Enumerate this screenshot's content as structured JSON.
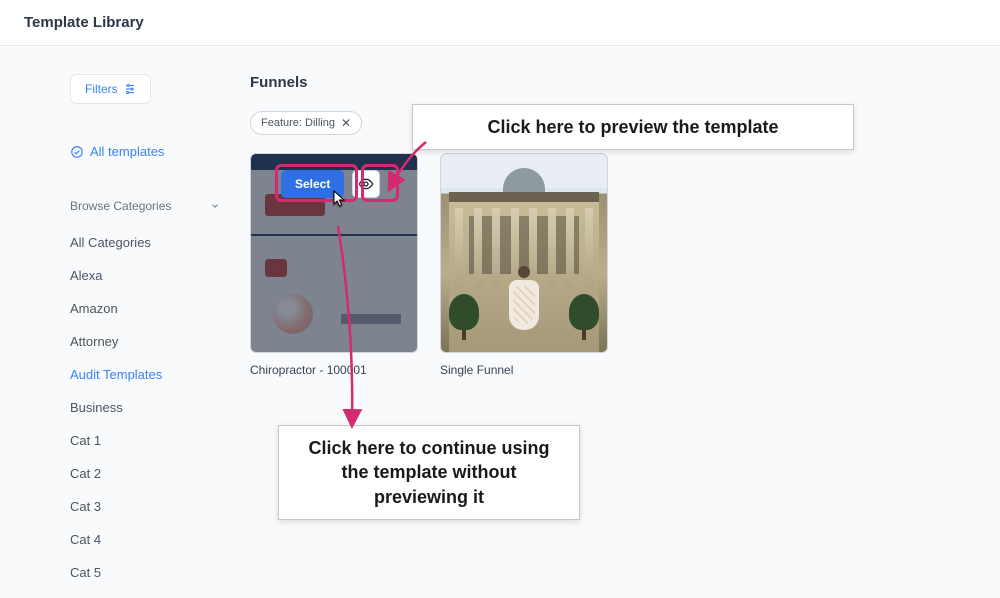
{
  "header": {
    "title": "Template Library"
  },
  "sidebar": {
    "filters_label": "Filters",
    "all_templates_label": "All templates",
    "browse_label": "Browse Categories",
    "categories": [
      {
        "label": "All Categories",
        "active": false
      },
      {
        "label": "Alexa",
        "active": false
      },
      {
        "label": "Amazon",
        "active": false
      },
      {
        "label": "Attorney",
        "active": false
      },
      {
        "label": "Audit Templates",
        "active": true
      },
      {
        "label": "Business",
        "active": false
      },
      {
        "label": "Cat 1",
        "active": false
      },
      {
        "label": "Cat 2",
        "active": false
      },
      {
        "label": "Cat 3",
        "active": false
      },
      {
        "label": "Cat 4",
        "active": false
      },
      {
        "label": "Cat 5",
        "active": false
      }
    ]
  },
  "main": {
    "section_title": "Funnels",
    "filter_chip": "Feature: Dilling",
    "cards": [
      {
        "title": "Chiropractor - 100001",
        "select_label": "Select"
      },
      {
        "title": "Single Funnel"
      }
    ]
  },
  "callouts": {
    "preview": "Click here to preview the template",
    "select": "Click here to continue using the template without previewing it"
  },
  "colors": {
    "accent": "#3b82f6",
    "button": "#2f6fe4",
    "highlight": "#d42a6f"
  }
}
